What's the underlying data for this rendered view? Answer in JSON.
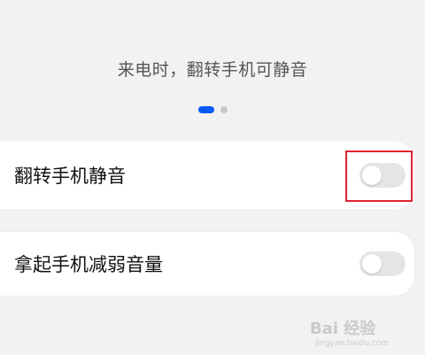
{
  "illustration": {
    "caption": "来电时，翻转手机可静音",
    "pager": {
      "count": 2,
      "active_index": 0
    }
  },
  "settings": [
    {
      "label": "翻转手机静音",
      "toggle_on": false,
      "highlighted": true
    },
    {
      "label": "拿起手机减弱音量",
      "toggle_on": false,
      "highlighted": false
    }
  ],
  "watermark": {
    "text": "Bai 经验",
    "subtext": "jingyan.baidu.com"
  },
  "colors": {
    "background": "#f2f2f2",
    "accent": "#0a59f7",
    "highlight": "#e0232f",
    "toggle_off": "#e5e5e5"
  }
}
